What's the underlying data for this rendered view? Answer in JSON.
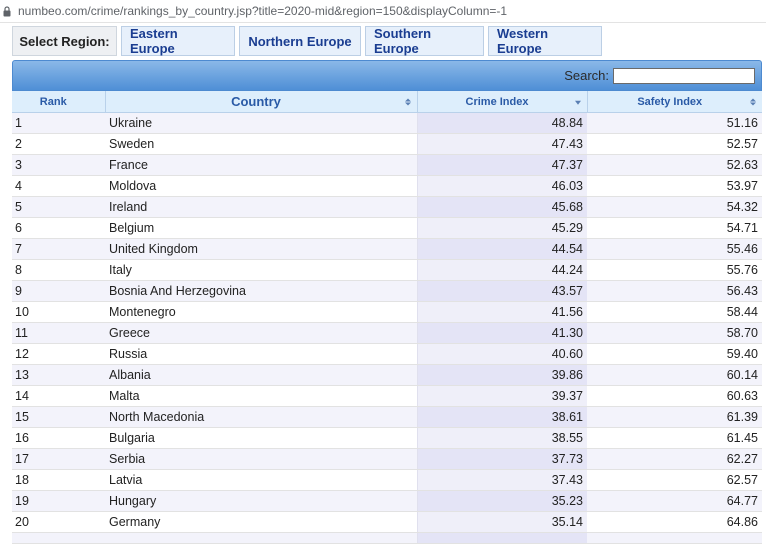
{
  "browser": {
    "url": "numbeo.com/crime/rankings_by_country.jsp?title=2020-mid&region=150&displayColumn=-1"
  },
  "region_bar": {
    "label": "Select Region:",
    "buttons": [
      "Eastern Europe",
      "Northern Europe",
      "Southern Europe",
      "Western Europe"
    ]
  },
  "search": {
    "label": "Search:",
    "value": ""
  },
  "table": {
    "headers": {
      "rank": "Rank",
      "country": "Country",
      "crime": "Crime Index",
      "safety": "Safety Index"
    },
    "rows": [
      {
        "rank": "1",
        "country": "Ukraine",
        "crime": "48.84",
        "safety": "51.16"
      },
      {
        "rank": "2",
        "country": "Sweden",
        "crime": "47.43",
        "safety": "52.57"
      },
      {
        "rank": "3",
        "country": "France",
        "crime": "47.37",
        "safety": "52.63"
      },
      {
        "rank": "4",
        "country": "Moldova",
        "crime": "46.03",
        "safety": "53.97"
      },
      {
        "rank": "5",
        "country": "Ireland",
        "crime": "45.68",
        "safety": "54.32"
      },
      {
        "rank": "6",
        "country": "Belgium",
        "crime": "45.29",
        "safety": "54.71"
      },
      {
        "rank": "7",
        "country": "United Kingdom",
        "crime": "44.54",
        "safety": "55.46"
      },
      {
        "rank": "8",
        "country": "Italy",
        "crime": "44.24",
        "safety": "55.76"
      },
      {
        "rank": "9",
        "country": "Bosnia And Herzegovina",
        "crime": "43.57",
        "safety": "56.43"
      },
      {
        "rank": "10",
        "country": "Montenegro",
        "crime": "41.56",
        "safety": "58.44"
      },
      {
        "rank": "11",
        "country": "Greece",
        "crime": "41.30",
        "safety": "58.70"
      },
      {
        "rank": "12",
        "country": "Russia",
        "crime": "40.60",
        "safety": "59.40"
      },
      {
        "rank": "13",
        "country": "Albania",
        "crime": "39.86",
        "safety": "60.14"
      },
      {
        "rank": "14",
        "country": "Malta",
        "crime": "39.37",
        "safety": "60.63"
      },
      {
        "rank": "15",
        "country": "North Macedonia",
        "crime": "38.61",
        "safety": "61.39"
      },
      {
        "rank": "16",
        "country": "Bulgaria",
        "crime": "38.55",
        "safety": "61.45"
      },
      {
        "rank": "17",
        "country": "Serbia",
        "crime": "37.73",
        "safety": "62.27"
      },
      {
        "rank": "18",
        "country": "Latvia",
        "crime": "37.43",
        "safety": "62.57"
      },
      {
        "rank": "19",
        "country": "Hungary",
        "crime": "35.23",
        "safety": "64.77"
      },
      {
        "rank": "20",
        "country": "Germany",
        "crime": "35.14",
        "safety": "64.86"
      }
    ]
  }
}
